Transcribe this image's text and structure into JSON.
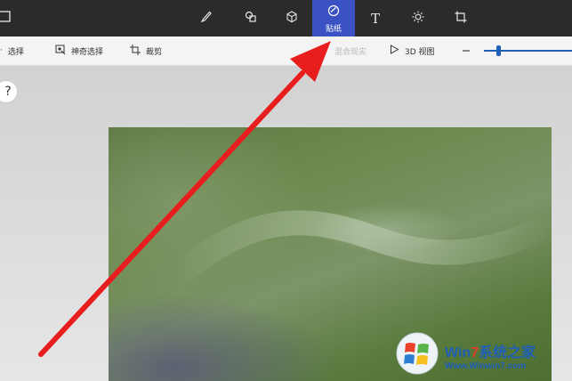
{
  "topbar": {
    "tools": [
      {
        "icon": "brush-icon",
        "label": ""
      },
      {
        "icon": "2d-shapes-icon",
        "label": ""
      },
      {
        "icon": "3d-shapes-icon",
        "label": ""
      },
      {
        "icon": "stickers-icon",
        "label": "贴纸",
        "selected": true
      },
      {
        "icon": "text-icon",
        "label": "T"
      },
      {
        "icon": "effects-icon",
        "label": ""
      },
      {
        "icon": "canvas-icon",
        "label": ""
      }
    ]
  },
  "toolbar": {
    "select_label": "选择",
    "magic_select_label": "神奇选择",
    "crop_label": "裁剪",
    "mixed_reality_label": "混合现实",
    "view_3d_label": "3D 视图",
    "zoom_minus": "—"
  },
  "help": {
    "label": "?"
  },
  "watermark": {
    "brand_prefix": "Win",
    "brand_seven": "7",
    "brand_suffix": "系统之家",
    "url": "Www.Winwin7.com"
  },
  "colors": {
    "topbar_bg": "#2b2b2b",
    "selected_tab": "#3b52c4",
    "arrow": "#e81e1e",
    "slider": "#1e5fb8"
  }
}
